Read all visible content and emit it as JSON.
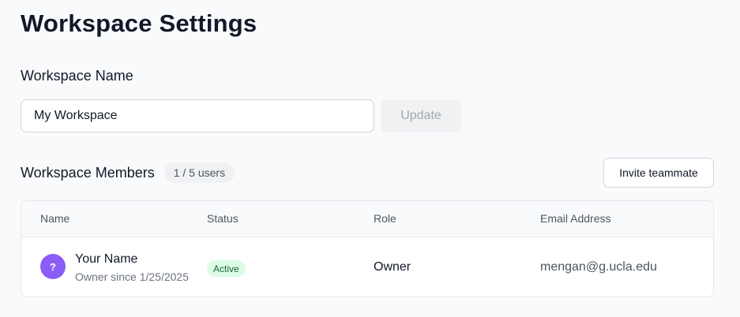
{
  "page": {
    "title": "Workspace Settings"
  },
  "workspace_name": {
    "label": "Workspace Name",
    "input_value": "My Workspace",
    "update_label": "Update"
  },
  "members": {
    "title": "Workspace Members",
    "count_badge": "1 / 5 users",
    "invite_label": "Invite teammate",
    "columns": [
      "Name",
      "Status",
      "Role",
      "Email Address"
    ],
    "rows": [
      {
        "avatar": "?",
        "name": "Your Name",
        "subtitle": "Owner since 1/25/2025",
        "status": "Active",
        "role": "Owner",
        "email": "mengan@g.ucla.edu"
      }
    ]
  },
  "colors": {
    "avatar_bg": "#8b5cf6",
    "status_active_bg": "#dcfce7",
    "status_active_text": "#166534"
  }
}
